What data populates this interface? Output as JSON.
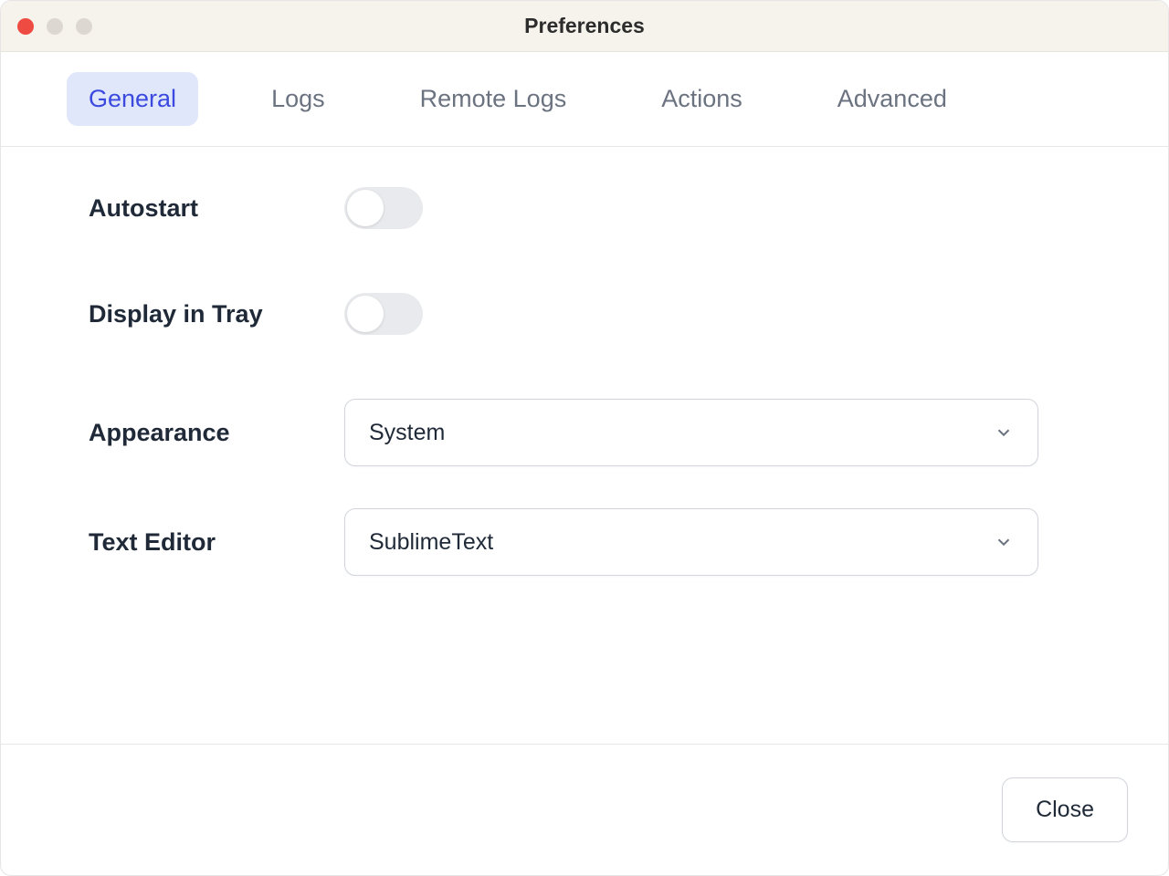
{
  "window": {
    "title": "Preferences"
  },
  "tabs": [
    {
      "label": "General",
      "active": true
    },
    {
      "label": "Logs",
      "active": false
    },
    {
      "label": "Remote Logs",
      "active": false
    },
    {
      "label": "Actions",
      "active": false
    },
    {
      "label": "Advanced",
      "active": false
    }
  ],
  "settings": {
    "autostart": {
      "label": "Autostart",
      "value": false
    },
    "display_in_tray": {
      "label": "Display in Tray",
      "value": false
    },
    "appearance": {
      "label": "Appearance",
      "selected": "System"
    },
    "text_editor": {
      "label": "Text Editor",
      "selected": "SublimeText"
    }
  },
  "footer": {
    "close_label": "Close"
  }
}
